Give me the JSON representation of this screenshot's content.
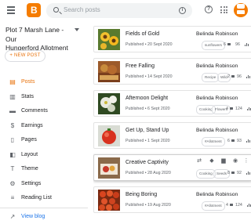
{
  "header": {
    "search_placeholder": "Search posts",
    "menu_icon": "hamburger-menu-icon",
    "logo_icon": "blogger-logo-icon",
    "help_icon": "help-icon",
    "apps_icon": "apps-grid-icon",
    "avatar_icon": "account-avatar-icon"
  },
  "sidebar": {
    "blog_title_line1": "Plot 7 Marsh Lane - Our",
    "blog_title_line2": "Hungerford Allotment Blog",
    "new_post_label": "+ NEW POST",
    "items": [
      {
        "label": "Posts",
        "icon": "posts-icon",
        "active": true
      },
      {
        "label": "Stats",
        "icon": "stats-icon"
      },
      {
        "label": "Comments",
        "icon": "comments-icon"
      },
      {
        "label": "Earnings",
        "icon": "earnings-icon"
      },
      {
        "label": "Pages",
        "icon": "pages-icon"
      },
      {
        "label": "Layout",
        "icon": "layout-icon"
      },
      {
        "label": "Theme",
        "icon": "theme-icon"
      },
      {
        "label": "Settings",
        "icon": "settings-icon"
      },
      {
        "label": "Reading List",
        "icon": "reading-list-icon"
      }
    ],
    "view_blog_label": "View blog",
    "accent_color": "#e8710a"
  },
  "posts": [
    {
      "title": "Fields of Gold",
      "meta": "Published • 20 Sept 2020",
      "author": "Belinda Robinson",
      "labels": [
        "sunflowers"
      ],
      "comments": "6",
      "views": "96"
    },
    {
      "title": "Free Falling",
      "meta": "Published • 14 Sept 2020",
      "author": "Belinda Robinson",
      "labels": [
        "Recipe",
        "Wild"
      ],
      "comments": "2",
      "views": "96"
    },
    {
      "title": "Afternoon Delight",
      "meta": "Published • 6 Sept 2020",
      "author": "Belinda Robinson",
      "labels": [
        "Cooking",
        "Flowers"
      ],
      "comments": "4",
      "views": "124"
    },
    {
      "title": "Get Up, Stand Up",
      "meta": "Published • 1 Sept 2020",
      "author": "Belinda Robinson",
      "labels": [
        "#Allotment"
      ],
      "comments": "6",
      "views": "93"
    },
    {
      "title": "Creative Captivity",
      "meta": "Published • 28 Aug 2020",
      "author": "",
      "labels": [
        "Cooking",
        "Seeds"
      ],
      "comments": "8",
      "views": "92"
    },
    {
      "title": "Being Boring",
      "meta": "Published • 19 Aug 2020",
      "author": "Belinda Robinson",
      "labels": [
        "#Allotment"
      ],
      "comments": "4",
      "views": "124"
    }
  ]
}
